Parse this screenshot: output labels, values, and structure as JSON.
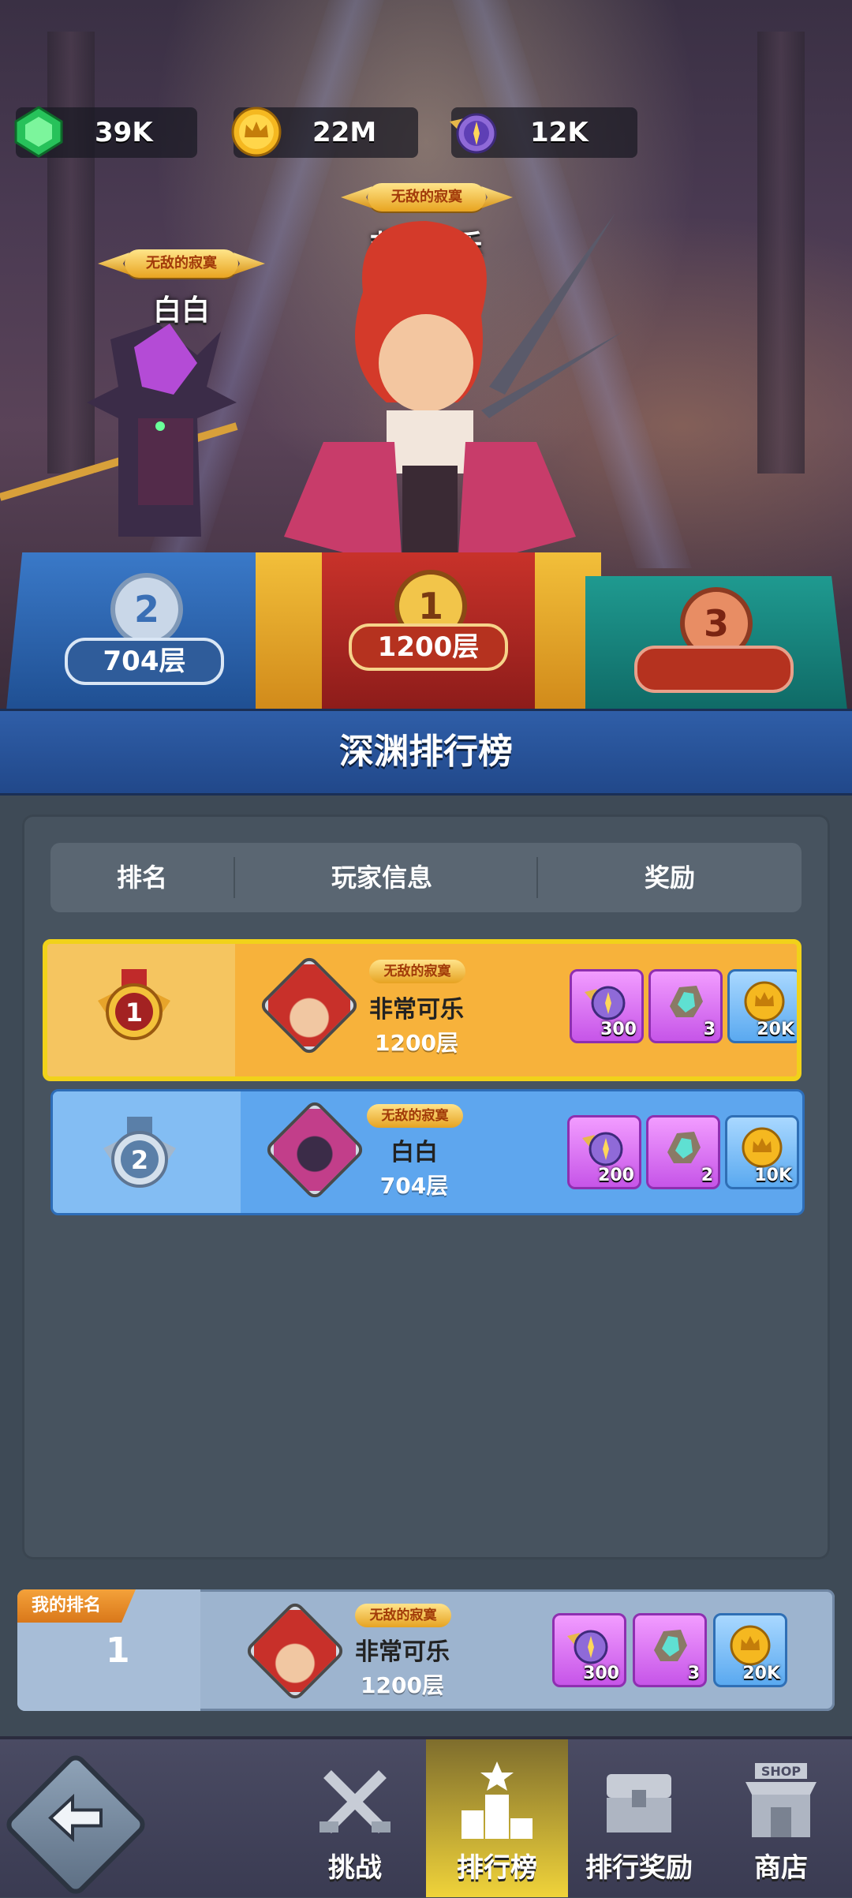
{
  "resources": [
    {
      "icon": "green-gem-icon",
      "value": "39K"
    },
    {
      "icon": "gold-crown-coin-icon",
      "value": "22M"
    },
    {
      "icon": "winged-compass-icon",
      "value": "12K"
    }
  ],
  "podium": {
    "first": {
      "title": "无敌的寂寞",
      "name": "非常可乐",
      "rank": "1",
      "floor": "1200层"
    },
    "second": {
      "title": "无敌的寂寞",
      "name": "白白",
      "rank": "2",
      "floor": "704层"
    },
    "third": {
      "rank": "3",
      "floor": ""
    }
  },
  "board": {
    "title": "深渊排行榜",
    "columns": [
      "排名",
      "玩家信息",
      "奖励"
    ],
    "rows": [
      {
        "rank": "1",
        "title": "无敌的寂寞",
        "name": "非常可乐",
        "floor": "1200层",
        "rewards": [
          {
            "icon": "winged-compass-icon",
            "count": "300"
          },
          {
            "icon": "crystal-ore-icon",
            "count": "3"
          },
          {
            "icon": "gold-crown-coin-icon",
            "count": "20K"
          }
        ]
      },
      {
        "rank": "2",
        "title": "无敌的寂寞",
        "name": "白白",
        "floor": "704层",
        "rewards": [
          {
            "icon": "winged-compass-icon",
            "count": "200"
          },
          {
            "icon": "crystal-ore-icon",
            "count": "2"
          },
          {
            "icon": "gold-crown-coin-icon",
            "count": "10K"
          }
        ]
      }
    ]
  },
  "my_rank": {
    "tag": "我的排名",
    "rank": "1",
    "title": "无敌的寂寞",
    "name": "非常可乐",
    "floor": "1200层",
    "rewards": [
      {
        "icon": "winged-compass-icon",
        "count": "300"
      },
      {
        "icon": "crystal-ore-icon",
        "count": "3"
      },
      {
        "icon": "gold-crown-coin-icon",
        "count": "20K"
      }
    ]
  },
  "nav": {
    "back": "back-arrow-icon",
    "tabs": [
      {
        "label": "挑战",
        "icon": "crossed-swords-icon",
        "active": false
      },
      {
        "label": "排行榜",
        "icon": "podium-star-icon",
        "active": true
      },
      {
        "label": "排行奖励",
        "icon": "treasure-chest-icon",
        "active": false
      },
      {
        "label": "商店",
        "icon": "shop-icon",
        "active": false,
        "icon_text": "SHOP"
      }
    ]
  },
  "colors": {
    "gold_row": "#f7b23b",
    "blue_row": "#5ea6ee",
    "header": "#2a579f",
    "active_tab": "#f0d33a"
  }
}
